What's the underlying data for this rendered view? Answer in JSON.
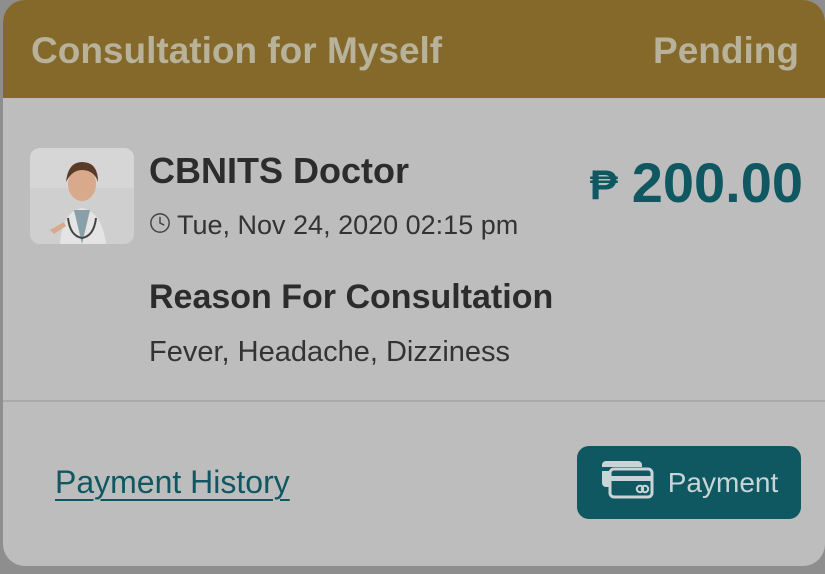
{
  "header": {
    "title": "Consultation for Myself",
    "status": "Pending"
  },
  "consultation": {
    "doctor_name": "CBNITS Doctor",
    "datetime": "Tue, Nov 24, 2020 02:15 pm",
    "currency_symbol": "₱",
    "amount": "200.00",
    "reason_title": "Reason For Consultation",
    "reason_text": "Fever, Headache, Dizziness"
  },
  "actions": {
    "payment_history_label": "Payment History",
    "payment_button_label": "Payment"
  },
  "icons": {
    "clock": "clock-icon",
    "payment": "credit-cards-icon"
  },
  "colors": {
    "header_bg": "#84692a",
    "accent": "#0f5862"
  }
}
